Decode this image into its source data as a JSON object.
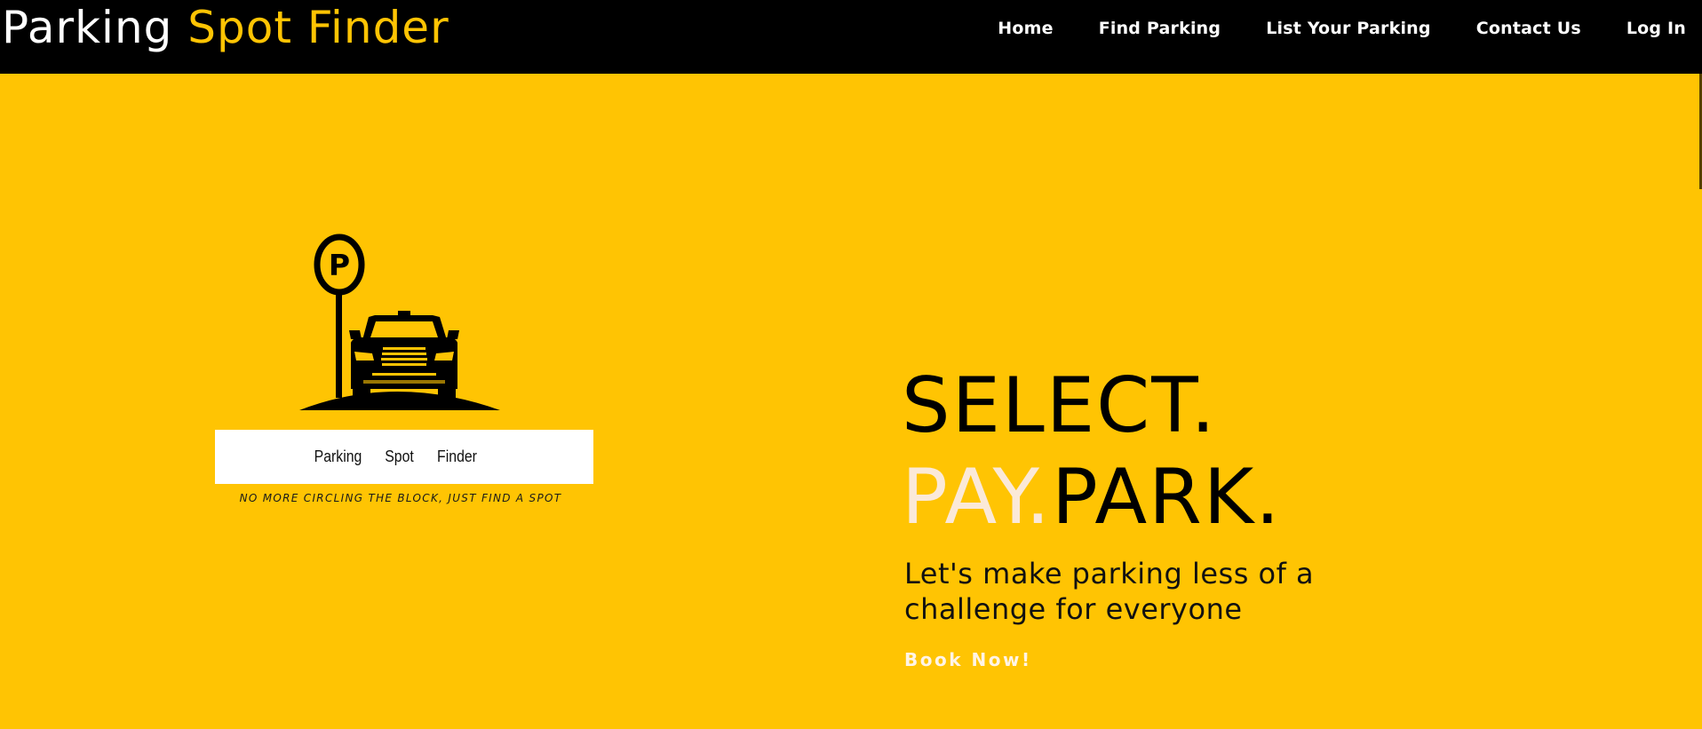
{
  "header": {
    "brand_part1": "Parking",
    "brand_part2": "Spot Finder",
    "nav": [
      "Home",
      "Find Parking",
      "List Your Parking",
      "Contact Us",
      "Log In"
    ]
  },
  "logo": {
    "words": [
      "Parking",
      "Spot",
      "Finder"
    ],
    "tagline": "NO MORE CIRCLING THE BLOCK, JUST FIND A SPOT",
    "sign_letter": "P"
  },
  "hero": {
    "line1": "SELECT.",
    "line2_a": "PAY.",
    "line2_b": "PARK.",
    "subheading": "Let's make parking less of a challenge for everyone",
    "cta_label": "Book Now!"
  },
  "colors": {
    "background": "#FFC403",
    "header": "#000000",
    "accent": "#FFC403",
    "pay_text": "#FBE9D8"
  }
}
